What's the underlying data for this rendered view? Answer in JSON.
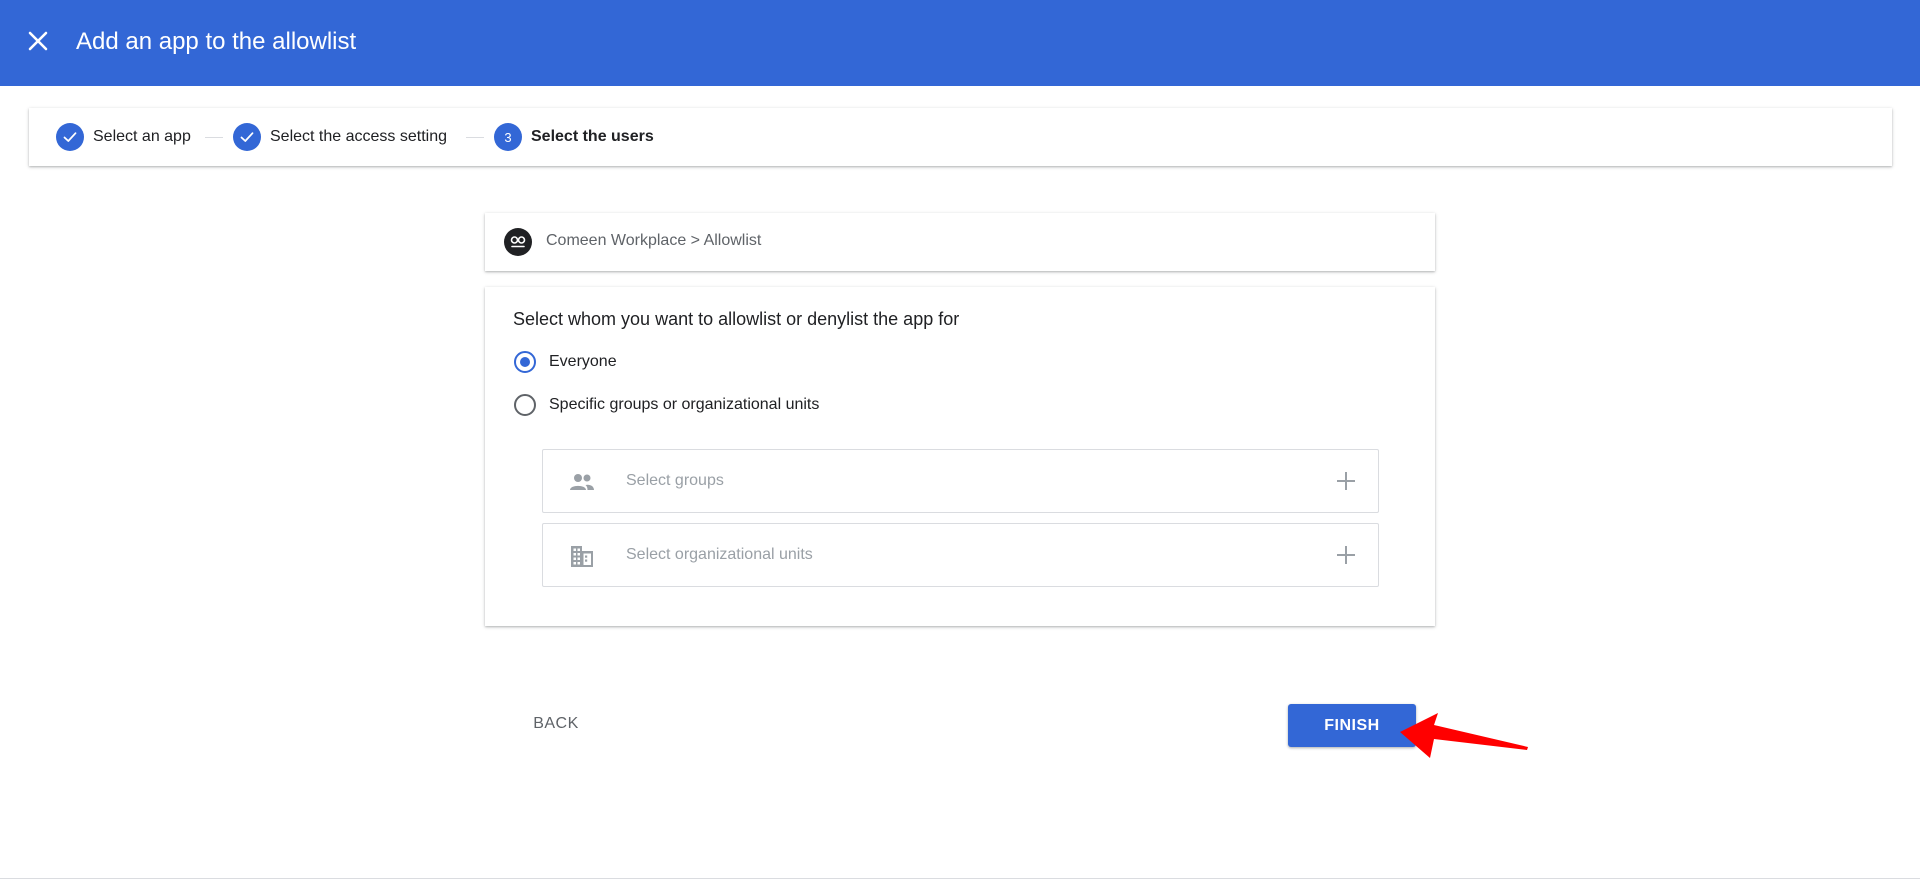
{
  "appbar": {
    "title": "Add an app to the allowlist",
    "close_icon": "close-icon"
  },
  "stepper": {
    "steps": [
      {
        "label": "Select an app",
        "state": "done"
      },
      {
        "label": "Select the access setting",
        "state": "done"
      },
      {
        "number": "3",
        "label": "Select the users",
        "state": "active"
      }
    ]
  },
  "breadcrumb": {
    "app_icon": "app-logo",
    "text": "Comeen Workplace > Allowlist"
  },
  "form": {
    "question": "Select whom you want to allowlist or denylist the app for",
    "options": [
      {
        "label": "Everyone",
        "selected": true
      },
      {
        "label": "Specific groups or organizational units",
        "selected": false
      }
    ],
    "pickers": [
      {
        "icon": "groups-icon",
        "placeholder": "Select groups"
      },
      {
        "icon": "building-icon",
        "placeholder": "Select organizational units"
      }
    ]
  },
  "actions": {
    "back_label": "BACK",
    "finish_label": "FINISH"
  },
  "colors": {
    "accent": "#3367d6",
    "annotation": "#ff0000"
  }
}
